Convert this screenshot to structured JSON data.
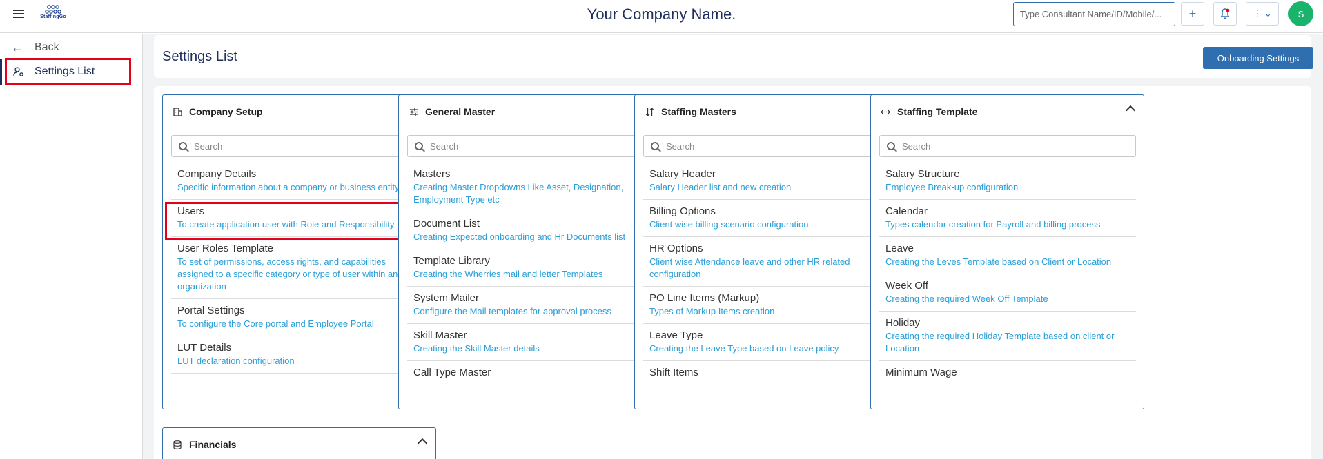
{
  "header": {
    "company_name": "Your Company Name.",
    "logo_text": "StaffingGo",
    "search_placeholder": "Type Consultant Name/ID/Mobile/...",
    "avatar_initial": "S",
    "plus_label": "+",
    "more_label": "⋮ ⌄"
  },
  "sidebar": {
    "back_label": "Back",
    "settings_label": "Settings List"
  },
  "main": {
    "title": "Settings List",
    "onboarding_button": "Onboarding Settings"
  },
  "cards": [
    {
      "title": "Company Setup",
      "icon": "building-icon",
      "search_placeholder": "Search",
      "items": [
        {
          "title": "Company Details",
          "desc": "Specific information about a company or business entity"
        },
        {
          "title": "Users",
          "desc": "To create application user with Role and Responsibility"
        },
        {
          "title": "User Roles Template",
          "desc": "To set of permissions, access rights, and capabilities assigned to a specific category or type of user within an organization"
        },
        {
          "title": "Portal Settings",
          "desc": "To configure the Core portal and Employee Portal"
        },
        {
          "title": "LUT Details",
          "desc": "LUT declaration configuration"
        }
      ]
    },
    {
      "title": "General Master",
      "icon": "sliders-icon",
      "search_placeholder": "Search",
      "items": [
        {
          "title": "Masters",
          "desc": "Creating Master Dropdowns Like Asset, Designation, Employment Type etc"
        },
        {
          "title": "Document List",
          "desc": "Creating Expected onboarding and Hr Documents list"
        },
        {
          "title": "Template Library",
          "desc": "Creating the Wherries mail and letter Templates"
        },
        {
          "title": "System Mailer",
          "desc": "Configure the Mail templates for approval process"
        },
        {
          "title": "Skill Master",
          "desc": "Creating the Skill Master details"
        },
        {
          "title": "Call Type Master",
          "desc": ""
        }
      ]
    },
    {
      "title": "Staffing Masters",
      "icon": "sort-icon",
      "search_placeholder": "Search",
      "items": [
        {
          "title": "Salary Header",
          "desc": "Salary Header list and new creation"
        },
        {
          "title": "Billing Options",
          "desc": "Client wise billing scenario configuration"
        },
        {
          "title": "HR Options",
          "desc": "Client wise Attendance leave and other HR related configuration"
        },
        {
          "title": "PO Line Items (Markup)",
          "desc": "Types of Markup Items creation"
        },
        {
          "title": "Leave Type",
          "desc": "Creating the Leave Type based on Leave policy"
        },
        {
          "title": "Shift Items",
          "desc": ""
        }
      ]
    },
    {
      "title": "Staffing Template",
      "icon": "code-icon",
      "search_placeholder": "Search",
      "items": [
        {
          "title": "Salary Structure",
          "desc": "Employee Break-up configuration"
        },
        {
          "title": "Calendar",
          "desc": "Types calendar creation for Payroll and billing process"
        },
        {
          "title": "Leave",
          "desc": "Creating the Leves Template based on Client or Location"
        },
        {
          "title": "Week Off",
          "desc": "Creating the required Week Off Template"
        },
        {
          "title": "Holiday",
          "desc": "Creating the required Holiday Template based on client or Location"
        },
        {
          "title": "Minimum Wage",
          "desc": ""
        }
      ]
    }
  ],
  "financials": {
    "title": "Financials",
    "icon": "database-icon"
  }
}
